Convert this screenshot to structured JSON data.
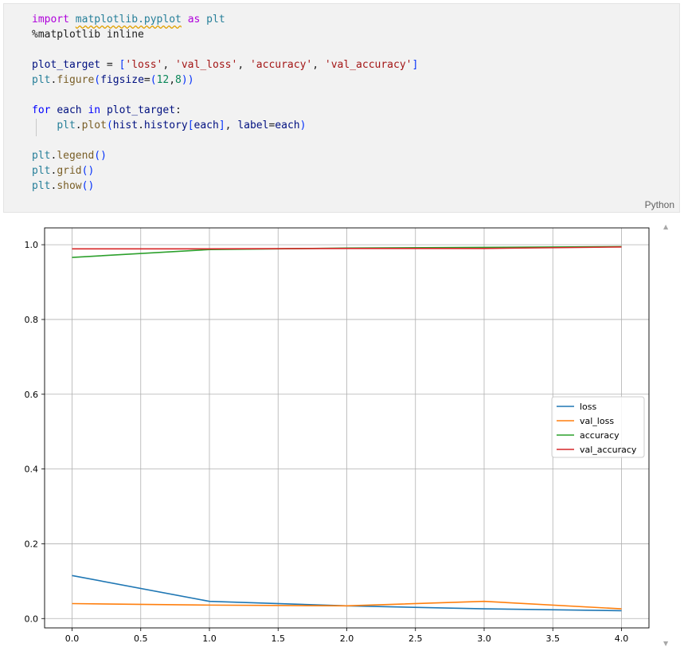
{
  "code_cell": {
    "language_label": "Python",
    "lines": {
      "l1": {
        "kw_import": "import",
        "module": "matplotlib.pyplot",
        "kw_as": "as",
        "alias": "plt"
      },
      "l2": {
        "magic": "%matplotlib inline"
      },
      "l4": {
        "var": "plot_target",
        "eq": " = ",
        "open": "[",
        "s1": "'loss'",
        "s2": "'val_loss'",
        "s3": "'accuracy'",
        "s4": "'val_accuracy'",
        "close": "]",
        "sep": ", "
      },
      "l5": {
        "obj": "plt",
        "fn": "figure",
        "param": "figsize",
        "n1": "12",
        "n2": "8"
      },
      "l7": {
        "kw_for": "for",
        "var": "each",
        "kw_in": "in",
        "target": "plot_target",
        "colon": ":"
      },
      "l8": {
        "obj": "plt",
        "fn": "plot",
        "arg1": "hist",
        "attr": "history",
        "idx": "each",
        "param": "label",
        "val": "each"
      },
      "l10": {
        "obj": "plt",
        "fn": "legend"
      },
      "l11": {
        "obj": "plt",
        "fn": "grid"
      },
      "l12": {
        "obj": "plt",
        "fn": "show"
      }
    }
  },
  "scrollbar": {
    "up_icon": "triangle-up-icon",
    "down_icon": "triangle-down-icon"
  },
  "chart_data": {
    "type": "line",
    "title": "",
    "xlabel": "",
    "ylabel": "",
    "x": [
      0,
      1,
      2,
      3,
      4
    ],
    "xlim": [
      -0.2,
      4.2
    ],
    "ylim": [
      -0.025,
      1.045
    ],
    "xticks": [
      "0.0",
      "0.5",
      "1.0",
      "1.5",
      "2.0",
      "2.5",
      "3.0",
      "3.5",
      "4.0"
    ],
    "yticks": [
      "0.0",
      "0.2",
      "0.4",
      "0.6",
      "0.8",
      "1.0"
    ],
    "grid": true,
    "legend": "center-right",
    "series": [
      {
        "name": "loss",
        "color": "#1f77b4",
        "values": [
          0.115,
          0.046,
          0.034,
          0.026,
          0.021
        ]
      },
      {
        "name": "val_loss",
        "color": "#ff7f0e",
        "values": [
          0.04,
          0.036,
          0.034,
          0.046,
          0.026
        ]
      },
      {
        "name": "accuracy",
        "color": "#2ca02c",
        "values": [
          0.966,
          0.987,
          0.991,
          0.993,
          0.995
        ]
      },
      {
        "name": "val_accuracy",
        "color": "#d62728",
        "values": [
          0.989,
          0.989,
          0.99,
          0.99,
          0.994
        ]
      }
    ]
  }
}
